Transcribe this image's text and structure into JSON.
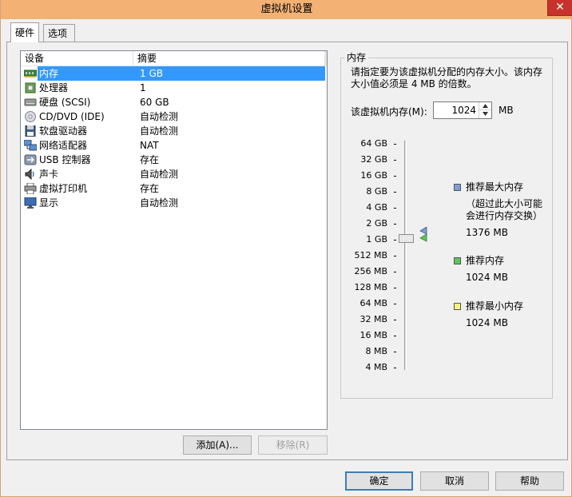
{
  "window": {
    "title": "虚拟机设置",
    "close_glyph": "✕"
  },
  "tabs": [
    {
      "label": "硬件",
      "active": true
    },
    {
      "label": "选项",
      "active": false
    }
  ],
  "device_list": {
    "columns": [
      "设备",
      "摘要"
    ],
    "rows": [
      {
        "name": "内存",
        "summary": "1 GB",
        "icon": "memory-icon",
        "selected": true
      },
      {
        "name": "处理器",
        "summary": "1",
        "icon": "processor-icon"
      },
      {
        "name": "硬盘 (SCSI)",
        "summary": "60 GB",
        "icon": "hard-disk-icon"
      },
      {
        "name": "CD/DVD (IDE)",
        "summary": "自动检测",
        "icon": "cd-dvd-icon"
      },
      {
        "name": "软盘驱动器",
        "summary": "自动检测",
        "icon": "floppy-icon"
      },
      {
        "name": "网络适配器",
        "summary": "NAT",
        "icon": "network-icon"
      },
      {
        "name": "USB 控制器",
        "summary": "存在",
        "icon": "usb-icon"
      },
      {
        "name": "声卡",
        "summary": "自动检测",
        "icon": "sound-icon"
      },
      {
        "name": "虚拟打印机",
        "summary": "存在",
        "icon": "printer-icon"
      },
      {
        "name": "显示",
        "summary": "自动检测",
        "icon": "display-icon"
      }
    ]
  },
  "buttons": {
    "add": "添加(A)...",
    "remove": "移除(R)",
    "ok": "确定",
    "cancel": "取消",
    "help": "帮助"
  },
  "memory_panel": {
    "group_title": "内存",
    "description": "请指定要为该虚拟机分配的内存大小。该内存大小值必须是 4 MB 的倍数。",
    "field_label": "该虚拟机内存(M):",
    "value": "1024",
    "unit": "MB",
    "scale_ticks": [
      "64 GB",
      "32 GB",
      "16 GB",
      "8 GB",
      "4 GB",
      "2 GB",
      "1 GB",
      "512 MB",
      "256 MB",
      "128 MB",
      "64 MB",
      "32 MB",
      "16 MB",
      "8 MB",
      "4 MB"
    ],
    "legend": [
      {
        "label": "推荐最大内存",
        "note": "（超过此大小可能会进行内存交换）",
        "value": "1376 MB",
        "color": "#7f9fd0"
      },
      {
        "label": "推荐内存",
        "value": "1024 MB",
        "color": "#5bc85b"
      },
      {
        "label": "推荐最小内存",
        "value": "1024 MB",
        "color": "#f5f57a"
      }
    ]
  }
}
